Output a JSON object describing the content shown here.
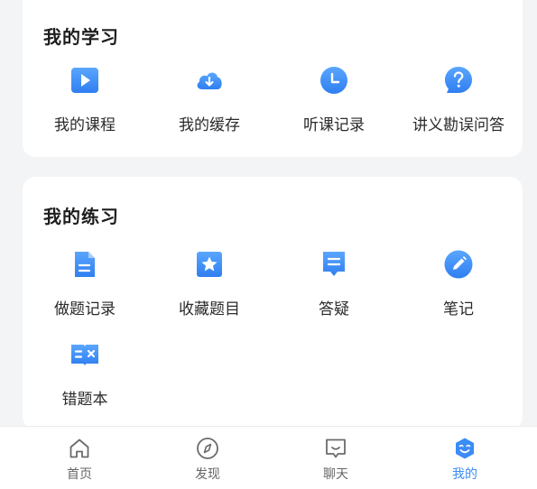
{
  "study": {
    "title": "我的学习",
    "items": [
      {
        "label": "我的课程",
        "icon": "play-icon"
      },
      {
        "label": "我的缓存",
        "icon": "cloud-download-icon"
      },
      {
        "label": "听课记录",
        "icon": "clock-icon"
      },
      {
        "label": "讲义勘误问答",
        "icon": "question-icon"
      }
    ]
  },
  "practice": {
    "title": "我的练习",
    "items": [
      {
        "label": "做题记录",
        "icon": "document-icon"
      },
      {
        "label": "收藏题目",
        "icon": "star-icon"
      },
      {
        "label": "答疑",
        "icon": "comment-icon"
      },
      {
        "label": "笔记",
        "icon": "pencil-icon"
      },
      {
        "label": "错题本",
        "icon": "wrong-book-icon"
      }
    ]
  },
  "tabbar": {
    "items": [
      {
        "label": "首页",
        "icon": "home-icon"
      },
      {
        "label": "发现",
        "icon": "compass-icon"
      },
      {
        "label": "聊天",
        "icon": "chat-icon"
      },
      {
        "label": "我的",
        "icon": "profile-icon",
        "active": true
      }
    ]
  },
  "colors": {
    "accent": "#3b8cf5",
    "accent_light": "#5aa6ff",
    "background": "#f3f4f6",
    "card": "#ffffff"
  }
}
